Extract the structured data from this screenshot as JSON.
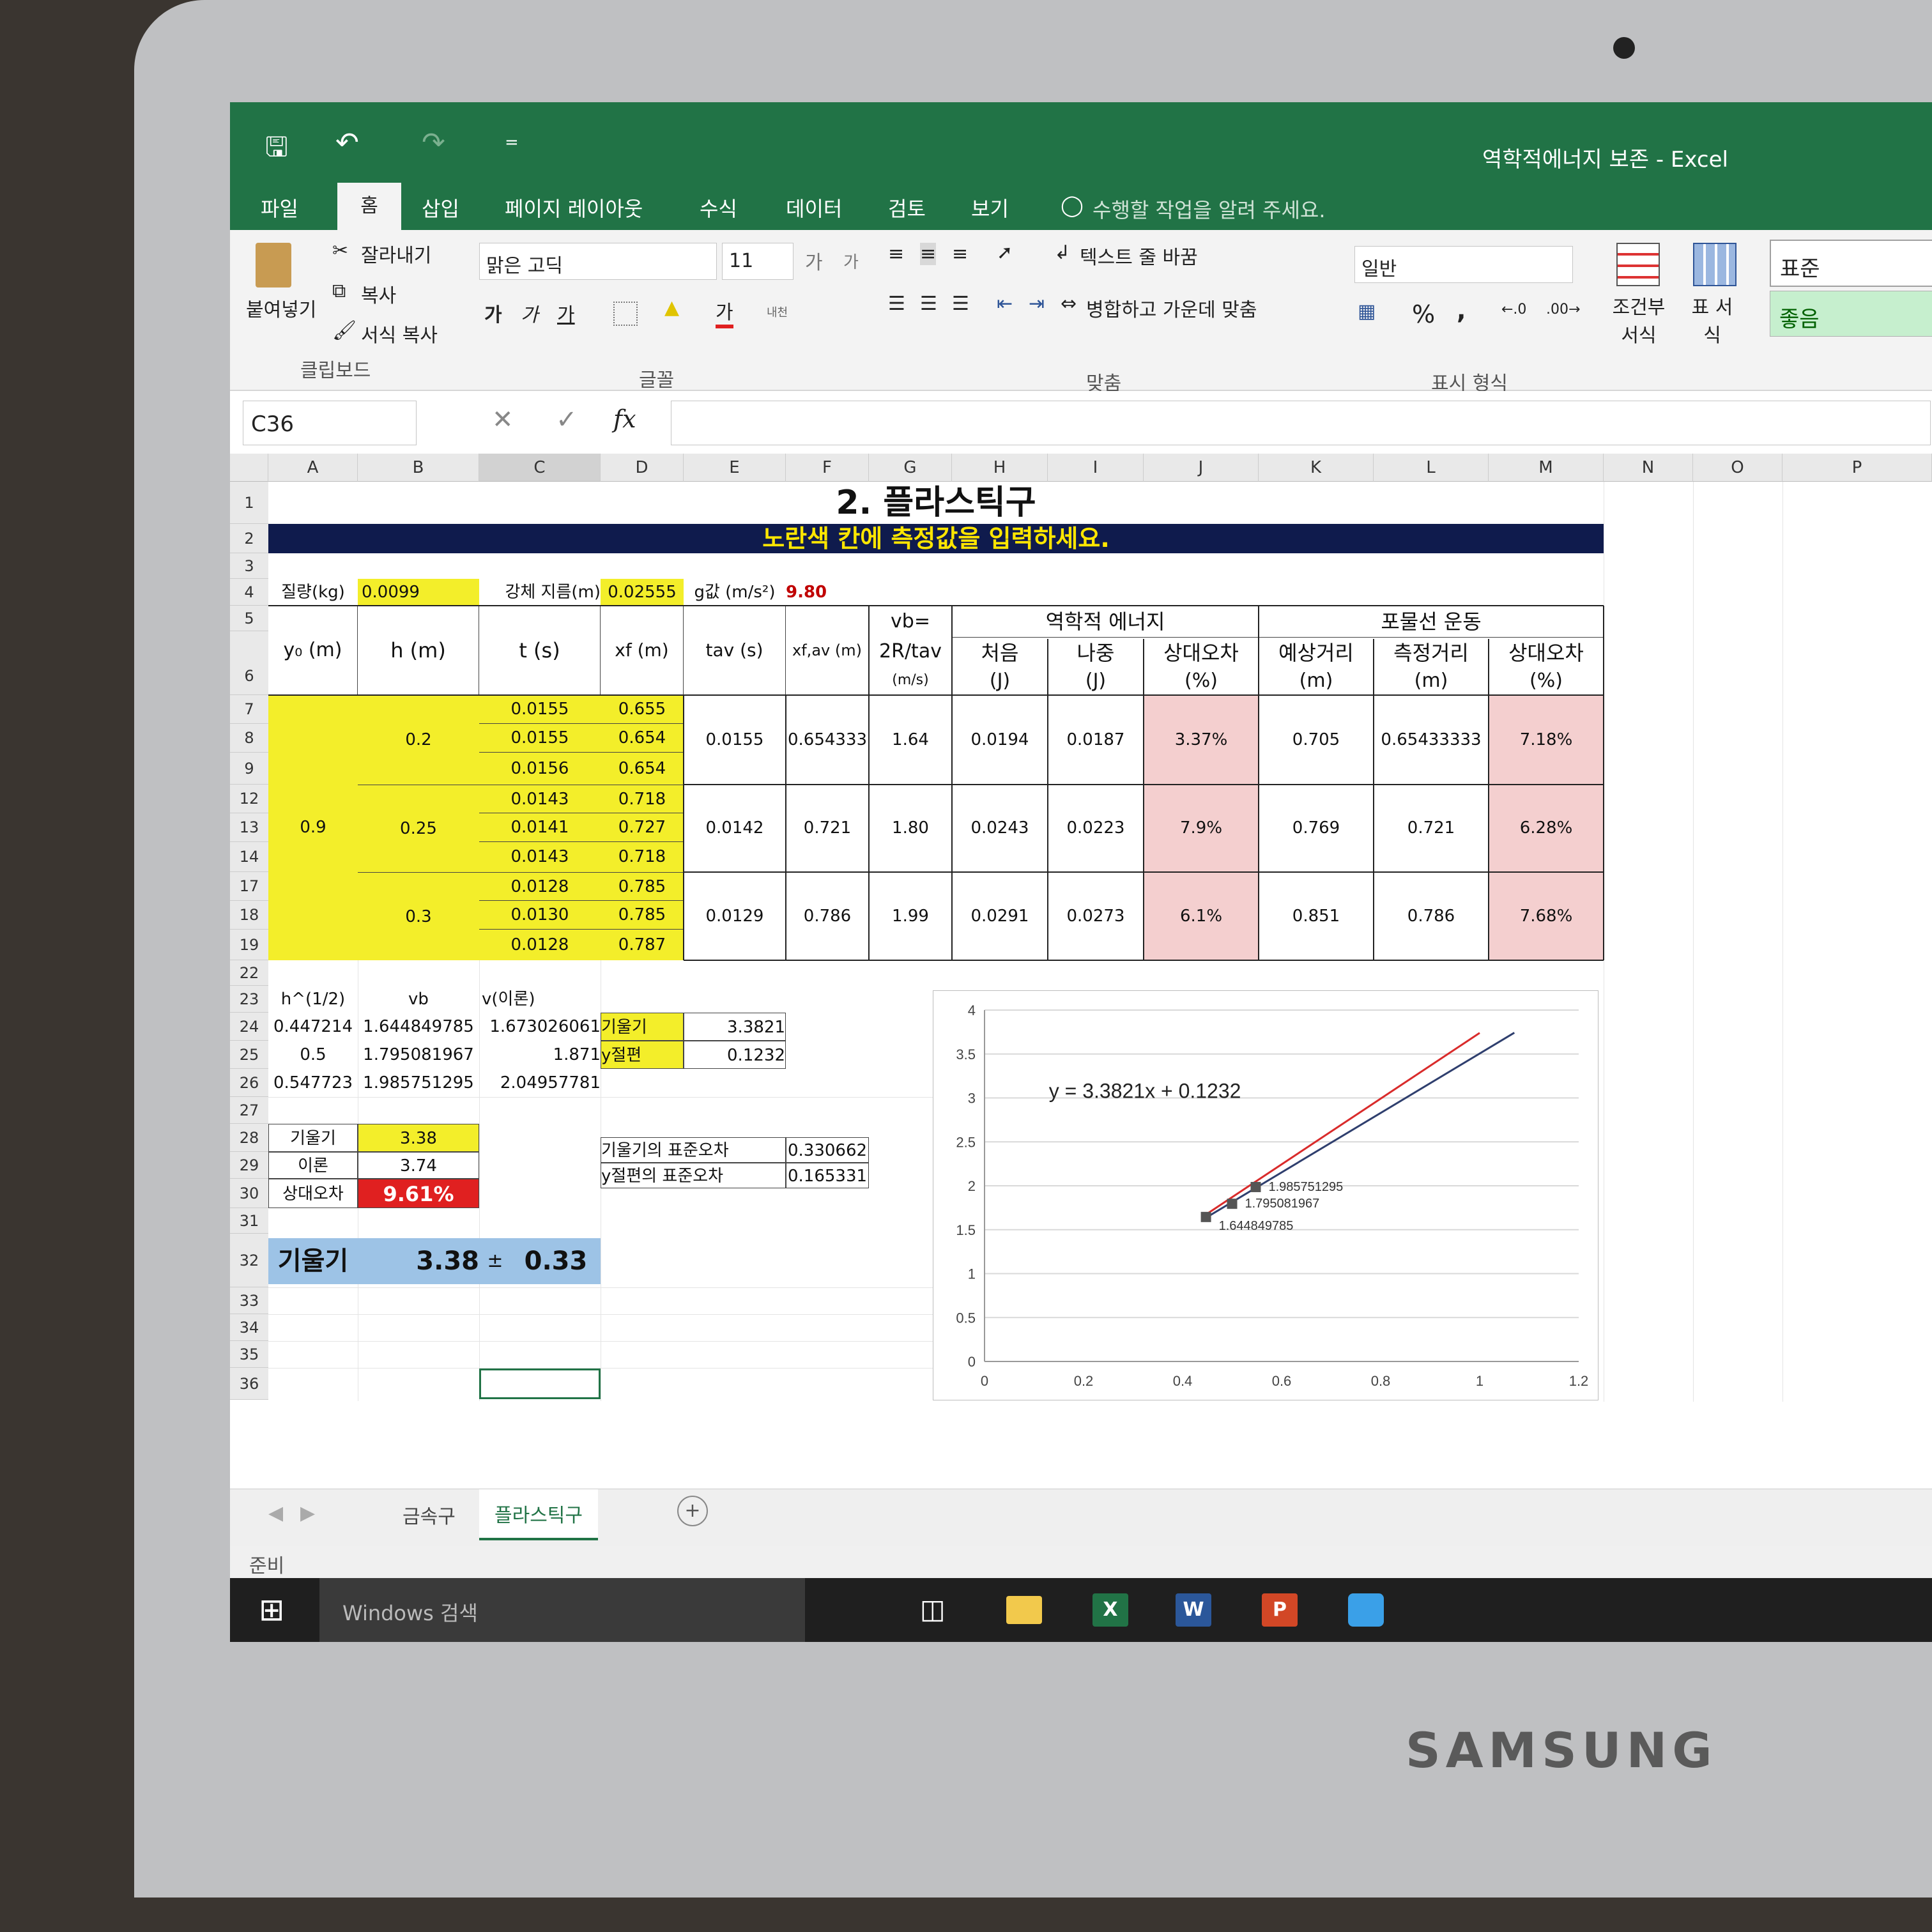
{
  "window": {
    "title": "역학적에너지 보존 - Excel",
    "qat_more": "="
  },
  "tabs": [
    "파일",
    "홈",
    "삽입",
    "페이지 레이아웃",
    "수식",
    "데이터",
    "검토",
    "보기"
  ],
  "tell_me": "수행할 작업을 알려 주세요.",
  "ribbon": {
    "clipboard": {
      "paste": "붙여넣기",
      "cut": "잘라내기",
      "copy": "복사",
      "format_painter": "서식 복사",
      "group": "클립보드"
    },
    "font": {
      "name": "맑은 고딕",
      "size": "11",
      "bold": "가",
      "italic": "가",
      "underline": "가",
      "grow": "가",
      "shrink": "가",
      "color_glyph": "가",
      "phonetic": "내천",
      "group": "글꼴"
    },
    "align": {
      "wrap": "텍스트 줄 바꿈",
      "merge": "병합하고 가운데 맞춤",
      "group": "맞춤"
    },
    "number": {
      "format": "일반",
      "percent": "%",
      "comma": ",",
      "group": "표시 형식"
    },
    "styles": {
      "conditional": "조건부 서식",
      "table": "표 서식",
      "normal": "표준",
      "good": "좋음"
    }
  },
  "formula_bar": {
    "name_box": "C36",
    "fx": "fx"
  },
  "columns": [
    "A",
    "B",
    "C",
    "D",
    "E",
    "F",
    "G",
    "H",
    "I",
    "J",
    "K",
    "L",
    "M",
    "N",
    "O",
    "P"
  ],
  "rows": [
    "1",
    "2",
    "3",
    "4",
    "5",
    "6",
    "7",
    "8",
    "9",
    "12",
    "13",
    "14",
    "17",
    "18",
    "19",
    "22",
    "23",
    "24",
    "25",
    "26",
    "27",
    "28",
    "29",
    "30",
    "31",
    "32",
    "33",
    "34",
    "35",
    "36"
  ],
  "sheet": {
    "title": "2. 플라스틱구",
    "instruction": "노란색 칸에 측정값을 입력하세요.",
    "mass_label": "질량(kg)",
    "mass": "0.0099",
    "diam_label": "강체 지름(m)",
    "diam": "0.02555",
    "g_label": "g값 (m/s²)",
    "g": "9.80",
    "headers": {
      "y0": "y₀ (m)",
      "h": "h (m)",
      "t": "t (s)",
      "xf": "xf (m)",
      "tav": "tav (s)",
      "xfav": "xf,av (m)",
      "vb1": "vb=",
      "vb2": "2R/tav",
      "vb3": "(m/s)",
      "mech": "역학적 에너지",
      "proj": "포물선 운동",
      "first": "처음",
      "first_u": "(J)",
      "later": "나중",
      "later_u": "(J)",
      "rel": "상대오차",
      "rel_u": "(%)",
      "pred": "예상거리",
      "pred_u": "(m)",
      "meas": "측정거리",
      "meas_u": "(m)",
      "rel2": "상대오차",
      "rel2_u": "(%)"
    },
    "y0": "0.9",
    "groups": [
      {
        "h": "0.2",
        "t": [
          "0.0155",
          "0.0155",
          "0.0156"
        ],
        "xf": [
          "0.655",
          "0.654",
          "0.654"
        ],
        "tav": "0.0155",
        "xfav": "0.654333",
        "vb": "1.64",
        "first": "0.0194",
        "later": "0.0187",
        "rel": "3.37%",
        "pred": "0.705",
        "meas": "0.65433333",
        "rel2": "7.18%"
      },
      {
        "h": "0.25",
        "t": [
          "0.0143",
          "0.0141",
          "0.0143"
        ],
        "xf": [
          "0.718",
          "0.727",
          "0.718"
        ],
        "tav": "0.0142",
        "xfav": "0.721",
        "vb": "1.80",
        "first": "0.0243",
        "later": "0.0223",
        "rel": "7.9%",
        "pred": "0.769",
        "meas": "0.721",
        "rel2": "6.28%"
      },
      {
        "h": "0.3",
        "t": [
          "0.0128",
          "0.0130",
          "0.0128"
        ],
        "xf": [
          "0.785",
          "0.785",
          "0.787"
        ],
        "tav": "0.0129",
        "xfav": "0.786",
        "vb": "1.99",
        "first": "0.0291",
        "later": "0.0273",
        "rel": "6.1%",
        "pred": "0.851",
        "meas": "0.786",
        "rel2": "7.68%"
      }
    ],
    "calc": {
      "h_half": "h^(1/2)",
      "vb": "vb",
      "v_theory": "v(이론)",
      "rows": [
        [
          "0.447214",
          "1.644849785",
          "1.673026061"
        ],
        [
          "0.5",
          "1.795081967",
          "1.871"
        ],
        [
          "0.547723",
          "1.985751295",
          "2.04957781"
        ]
      ],
      "slope_label": "기울기",
      "slope_val": "3.3821",
      "yint_label": "y절편",
      "yint_val": "0.1232",
      "s_label": "기울기",
      "s_val": "3.38",
      "th_label": "이론",
      "th_val": "3.74",
      "re_label": "상대오차",
      "re_val": "9.61%",
      "se_slope_label": "기울기의 표준오차",
      "se_slope": "0.330662",
      "se_yint_label": "y절편의 표준오차",
      "se_yint": "0.165331",
      "final_label": "기울기",
      "final_val": "3.38",
      "pm": "±",
      "final_err": "0.33"
    }
  },
  "chart_data": {
    "type": "scatter",
    "title": "",
    "xlim": [
      0,
      1.2
    ],
    "ylim": [
      0,
      4
    ],
    "xticks": [
      "0",
      "0.2",
      "0.4",
      "0.6",
      "0.8",
      "1",
      "1.2"
    ],
    "yticks": [
      "0",
      "0.5",
      "1",
      "1.5",
      "2",
      "2.5",
      "3",
      "3.5",
      "4"
    ],
    "equation": "y = 3.3821x + 0.1232",
    "points": [
      {
        "x": 0.447214,
        "y": 1.644849785,
        "label": "1.644849785"
      },
      {
        "x": 0.5,
        "y": 1.795081967,
        "label": "1.795081967"
      },
      {
        "x": 0.547723,
        "y": 1.985751295,
        "label": "1.985751295"
      }
    ],
    "trendline": {
      "slope": 3.3821,
      "intercept": 0.1232,
      "x_end": 1.07
    },
    "theory_line": {
      "x": [
        0.447214,
        0.5,
        0.547723,
        1.0
      ],
      "slope": 3.74
    },
    "colors": {
      "trend": "#2f3f6e",
      "theory": "#d92b2b",
      "points": "#555555"
    }
  },
  "sheet_tabs": [
    "금속구",
    "플라스틱구"
  ],
  "add_sheet": "+",
  "status": "준비",
  "taskbar": {
    "search": "Windows 검색"
  },
  "brand": "SAMSUNG"
}
